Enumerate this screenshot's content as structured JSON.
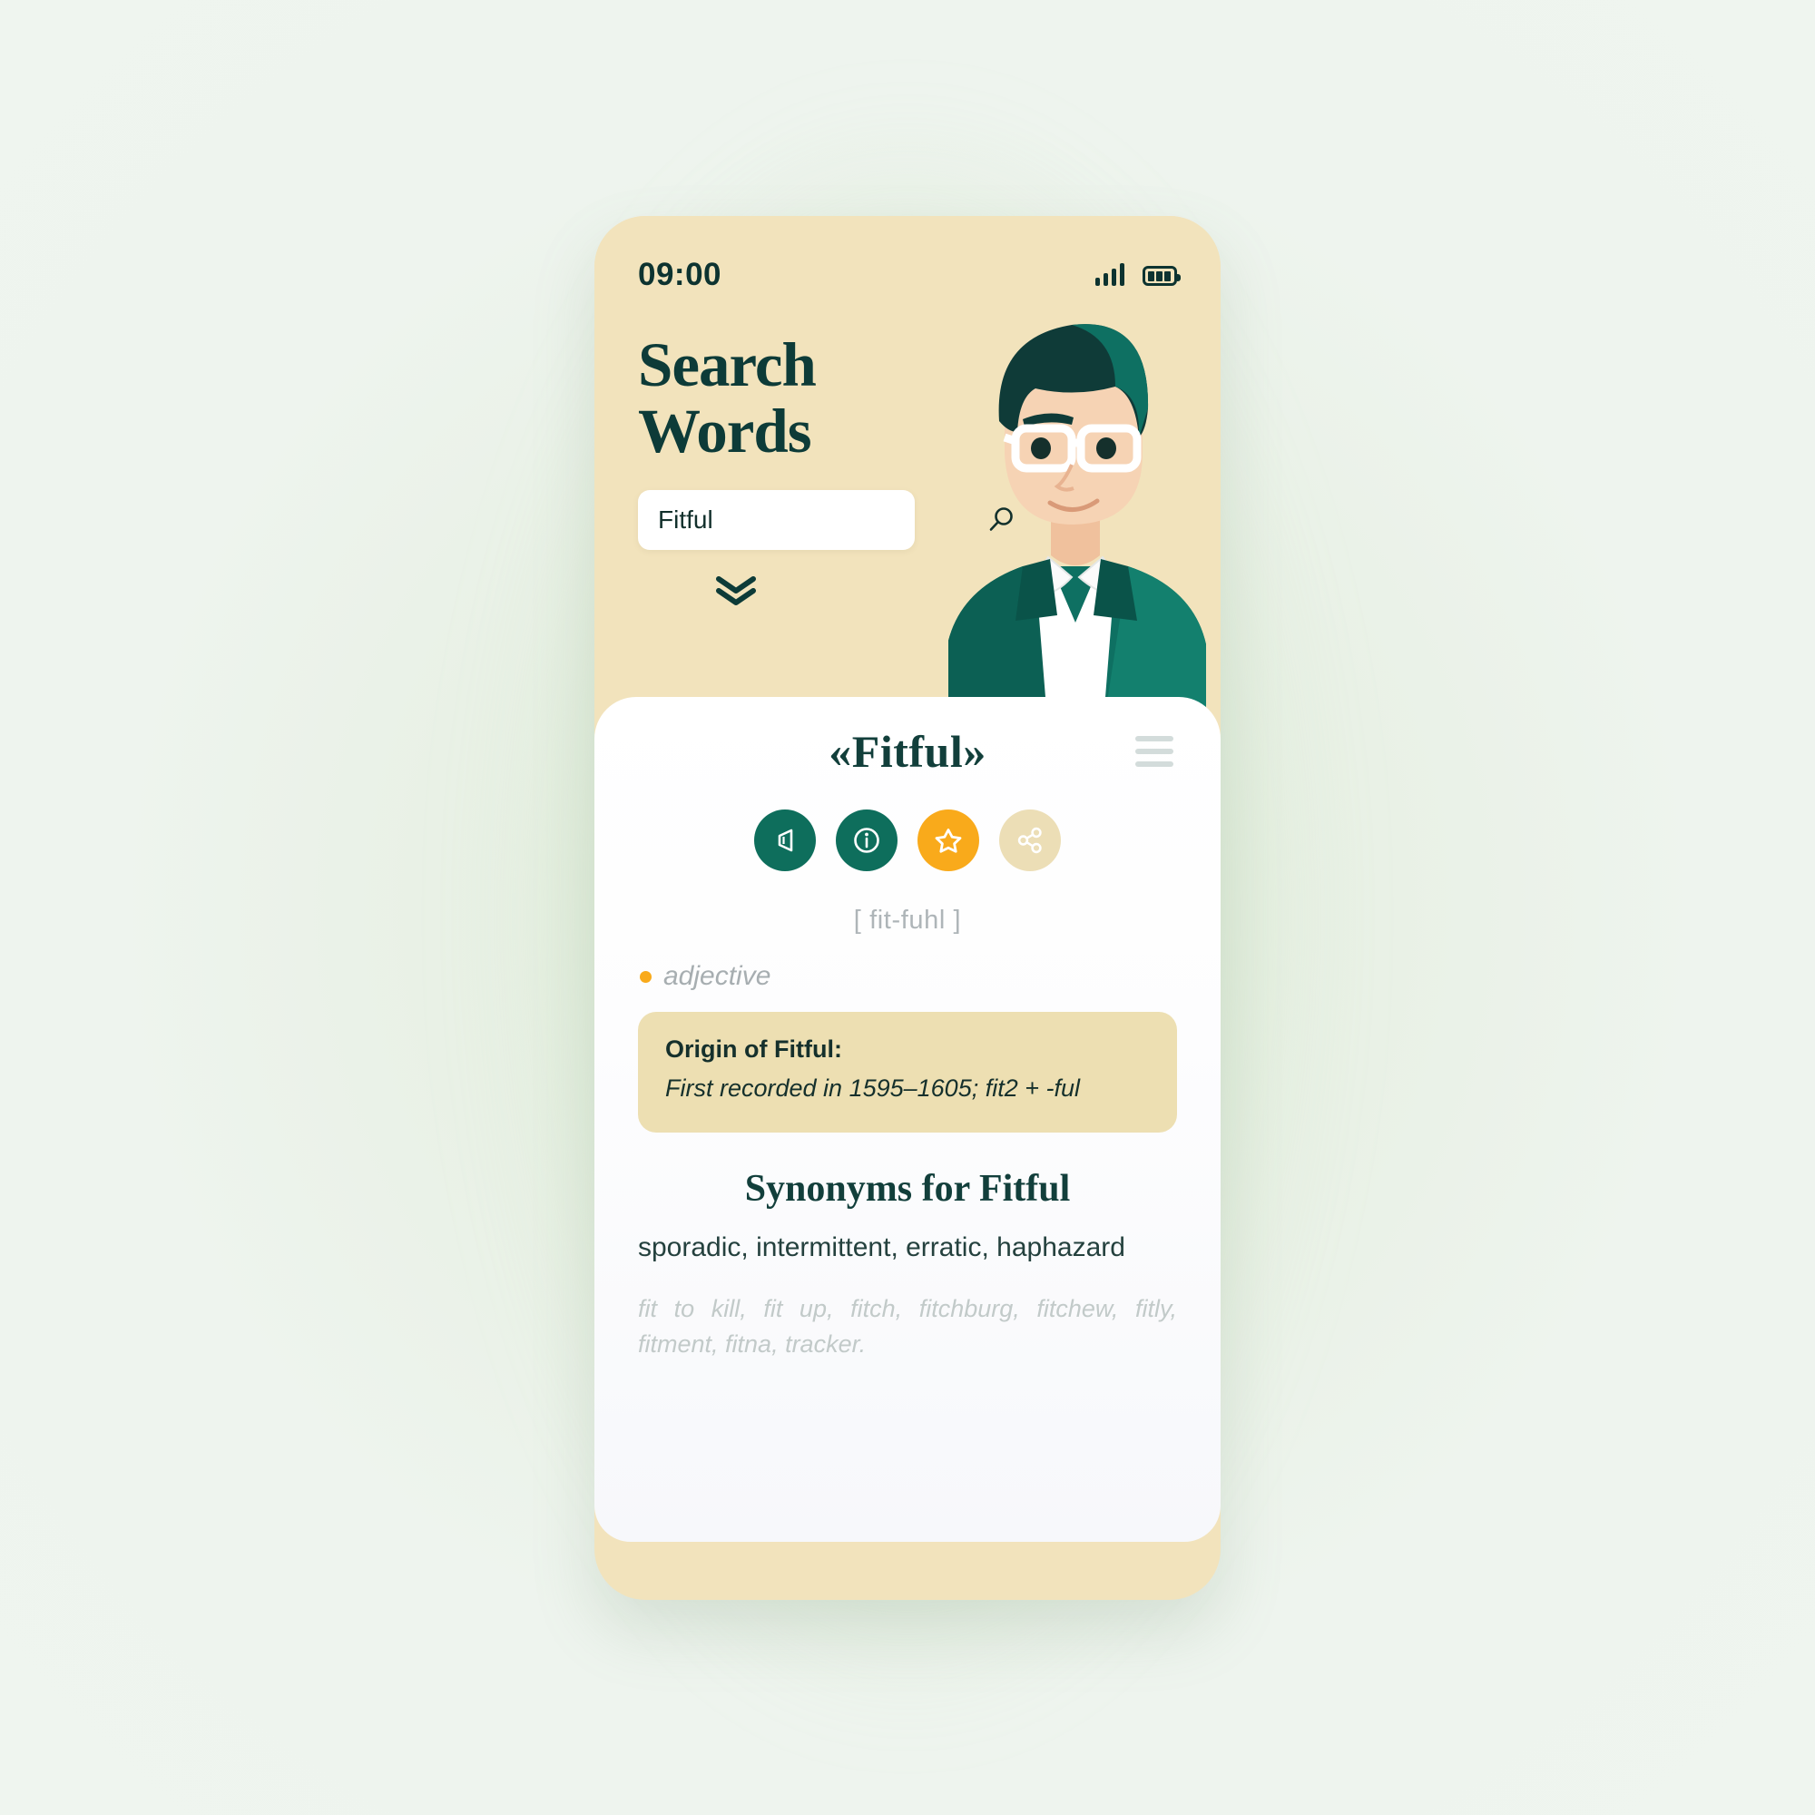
{
  "statusbar": {
    "time": "09:00",
    "signal_icon": "signal-bars-icon",
    "battery_icon": "battery-icon"
  },
  "header": {
    "title_line1": "Search",
    "title_line2": "Words",
    "search": {
      "value": "Fitful",
      "placeholder": "Search a word",
      "icon": "search-icon"
    },
    "scroll_hint_icon": "double-chevron-down-icon",
    "illustration": "man-with-glasses-illustration",
    "background_color": "#F2E3BC"
  },
  "panel": {
    "word_title": "«Fitful»",
    "menu_icon": "hamburger-menu-icon",
    "actions": [
      {
        "name": "pronounce-button",
        "icon": "speaker-icon",
        "color": "#0E6E5C"
      },
      {
        "name": "info-button",
        "icon": "info-icon",
        "color": "#0E6E5C"
      },
      {
        "name": "favorite-button",
        "icon": "star-icon",
        "color": "#F9AA1B"
      },
      {
        "name": "share-button",
        "icon": "share-icon",
        "color": "#ECDEB6"
      }
    ],
    "pronunciation": "[ fit-fuhl ]",
    "part_of_speech": "adjective",
    "origin": {
      "title": "Origin of Fitful:",
      "text": "First recorded in 1595–1605; fit2 + -ful"
    },
    "synonyms_title": "Synonyms for Fitful",
    "synonyms": "sporadic,   intermittent,   erratic, haphazard",
    "related_words": "fit to kill, fit up, fitch, fitchburg, fitchew, fitly, fitment, fitna, tracker."
  },
  "theme": {
    "accent_teal": "#0E6E5C",
    "accent_amber": "#F9AA1B",
    "dark_green": "#123F3B",
    "sand": "#EDDFB2"
  }
}
